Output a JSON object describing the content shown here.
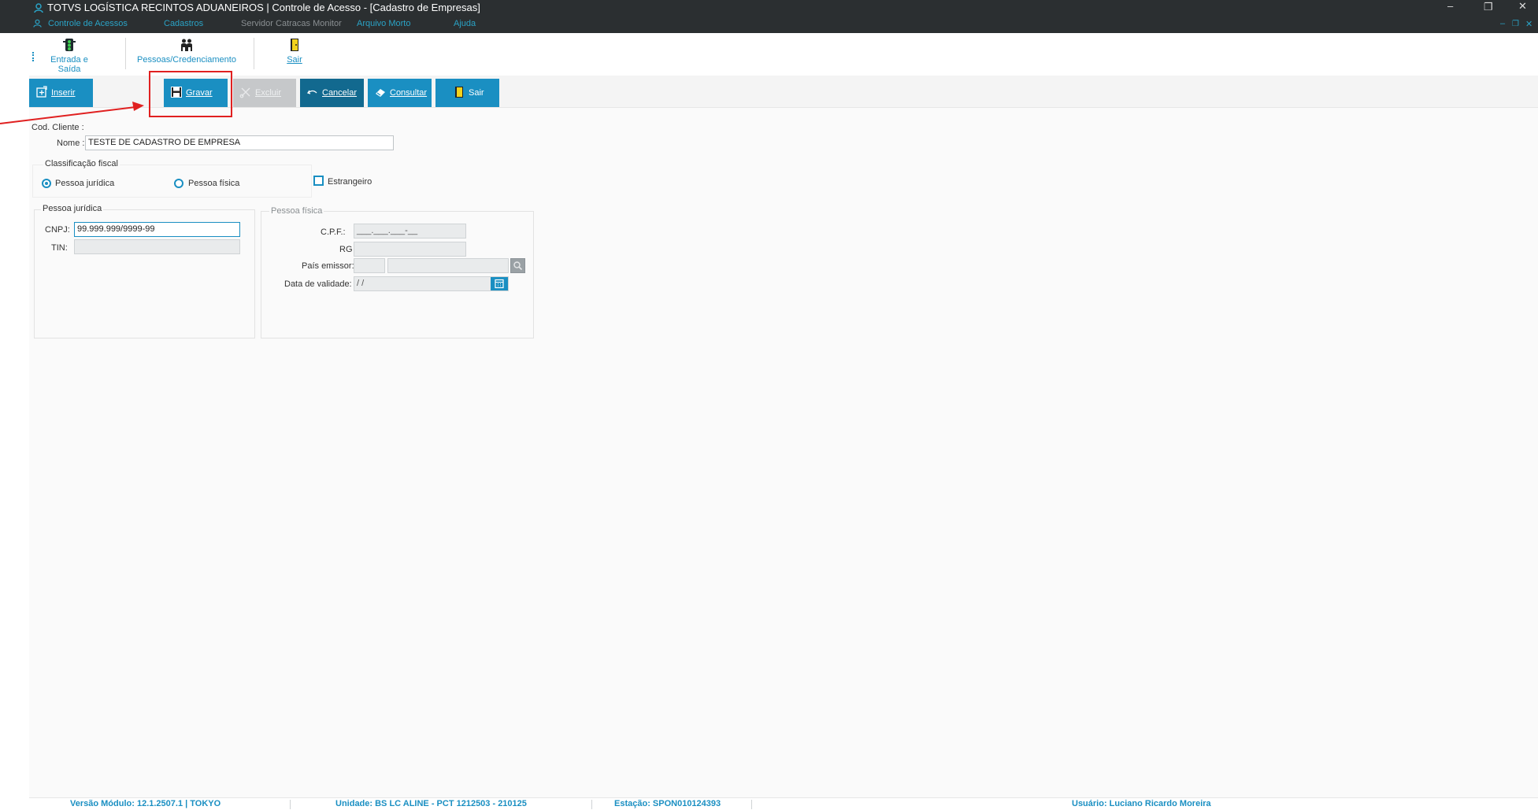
{
  "window": {
    "title": "TOTVS LOGÍSTICA RECINTOS ADUANEIROS | Controle de Acesso - [Cadastro de Empresas]",
    "controls": {
      "minimize": "–",
      "restore": "❐",
      "close": "✕"
    },
    "mdi_controls": {
      "minimize": "–",
      "restore": "❐",
      "close": "✕"
    }
  },
  "menu": [
    "Controle de Acessos",
    "Cadastros",
    "Servidor Catracas Monitor",
    "Arquivo Morto",
    "Ajuda"
  ],
  "top_toolbar": {
    "entrada_saida": "Entrada e Saída",
    "pessoas": "Pessoas/Credenciamento",
    "sair": "Sair"
  },
  "actions": {
    "inserir": "Inserir",
    "gravar": "Gravar",
    "excluir": "Excluir",
    "cancelar": "Cancelar",
    "consultar": "Consultar",
    "sair": "Sair"
  },
  "form": {
    "cod_cliente_label": "Cod. Cliente :",
    "nome_label": "Nome :",
    "nome_value": "TESTE DE CADASTRO DE EMPRESA",
    "classificacao_title": "Classificação fiscal",
    "pessoa_juridica_option": "Pessoa jurídica",
    "pessoa_fisica_option": "Pessoa física",
    "estrangeiro_label": "Estrangeiro",
    "pj_group_title": "Pessoa jurídica",
    "cnpj_label": "CNPJ:",
    "cnpj_value": "99.999.999/9999-99",
    "tin_label": "TIN:",
    "pf_group_title": "Pessoa física",
    "cpf_label": "C.P.F.:",
    "cpf_value": "___.___.___-__",
    "rg_label": "RG",
    "pais_label": "País emissor:",
    "data_label": "Data de validade:",
    "data_value": " / /"
  },
  "status": {
    "versao": "Versão Módulo:  12.1.2507.1  |  TOKYO",
    "unidade": "Unidade: BS LC ALINE - PCT 1212503 - 210125",
    "estacao": "Estação: SPON010124393",
    "usuario": "Usuário: Luciano Ricardo Moreira"
  },
  "colors": {
    "accent": "#1a8fc2",
    "titlebar": "#2b2f31",
    "highlight": "#e02020"
  }
}
